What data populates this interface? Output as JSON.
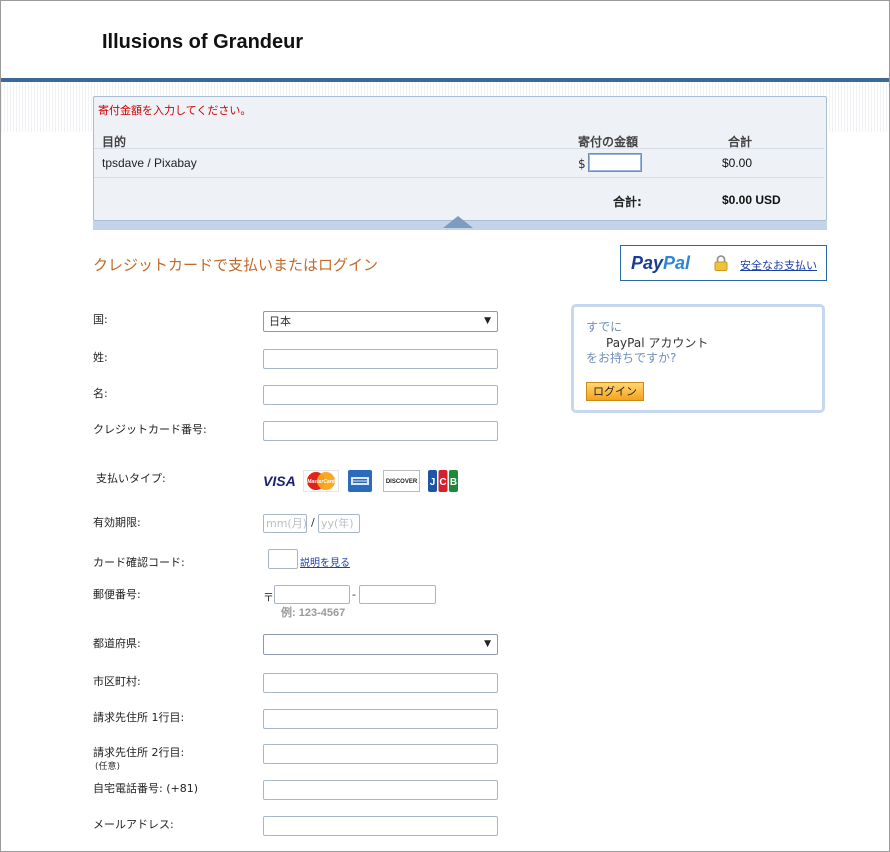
{
  "site": {
    "title": "Illusions of Grandeur"
  },
  "cart": {
    "error_message": "寄付金額を入力してください。",
    "headers": {
      "purpose": "目的",
      "amount": "寄付の金額",
      "total": "合計"
    },
    "row": {
      "item": "tpsdave / Pixabay",
      "currency_symbol": "$",
      "amount_value": "",
      "row_total": "$0.00"
    },
    "sum_label": "合計:",
    "sum_value": "$0.00 USD"
  },
  "section_title": "クレジットカードで支払いまたはログイン",
  "paypal": {
    "logo_pay": "Pay",
    "logo_pal": "Pal",
    "secure_link": "安全なお支払い"
  },
  "form": {
    "country_label": "国:",
    "country_value": "日本",
    "last_name_label": "姓:",
    "first_name_label": "名:",
    "card_number_label": "クレジットカード番号:",
    "payment_type_label": "支払いタイプ:",
    "card_brands": [
      "VISA",
      "MasterCard",
      "American Express",
      "DISCOVER",
      "JCB"
    ],
    "expiry_label": "有効期限:",
    "expiry_month_placeholder": "mm(月)",
    "expiry_separator": "/",
    "expiry_year_placeholder": "yy(年)",
    "cvv_label": "カード確認コード:",
    "cvv_help_link": "説明を見る",
    "postal_label": "郵便番号:",
    "postal_mark": "〒",
    "postal_separator": "-",
    "postal_example": "例: 123-4567",
    "prefecture_label": "都道府県:",
    "city_label": "市区町村:",
    "address1_label": "請求先住所 1行目:",
    "address2_label": "請求先住所 2行目:",
    "address2_note": "(任意)",
    "phone_label": "自宅電話番号: (+81)",
    "email_label": "メールアドレス:"
  },
  "login_box": {
    "line1": "すでに",
    "line2": "PayPal アカウント",
    "line3": "をお持ちですか?",
    "button": "ログイン"
  },
  "colors": {
    "header_rule": "#3c6a98",
    "section_title": "#c2692a",
    "error": "#cc0000",
    "link": "#1c3fa8"
  }
}
